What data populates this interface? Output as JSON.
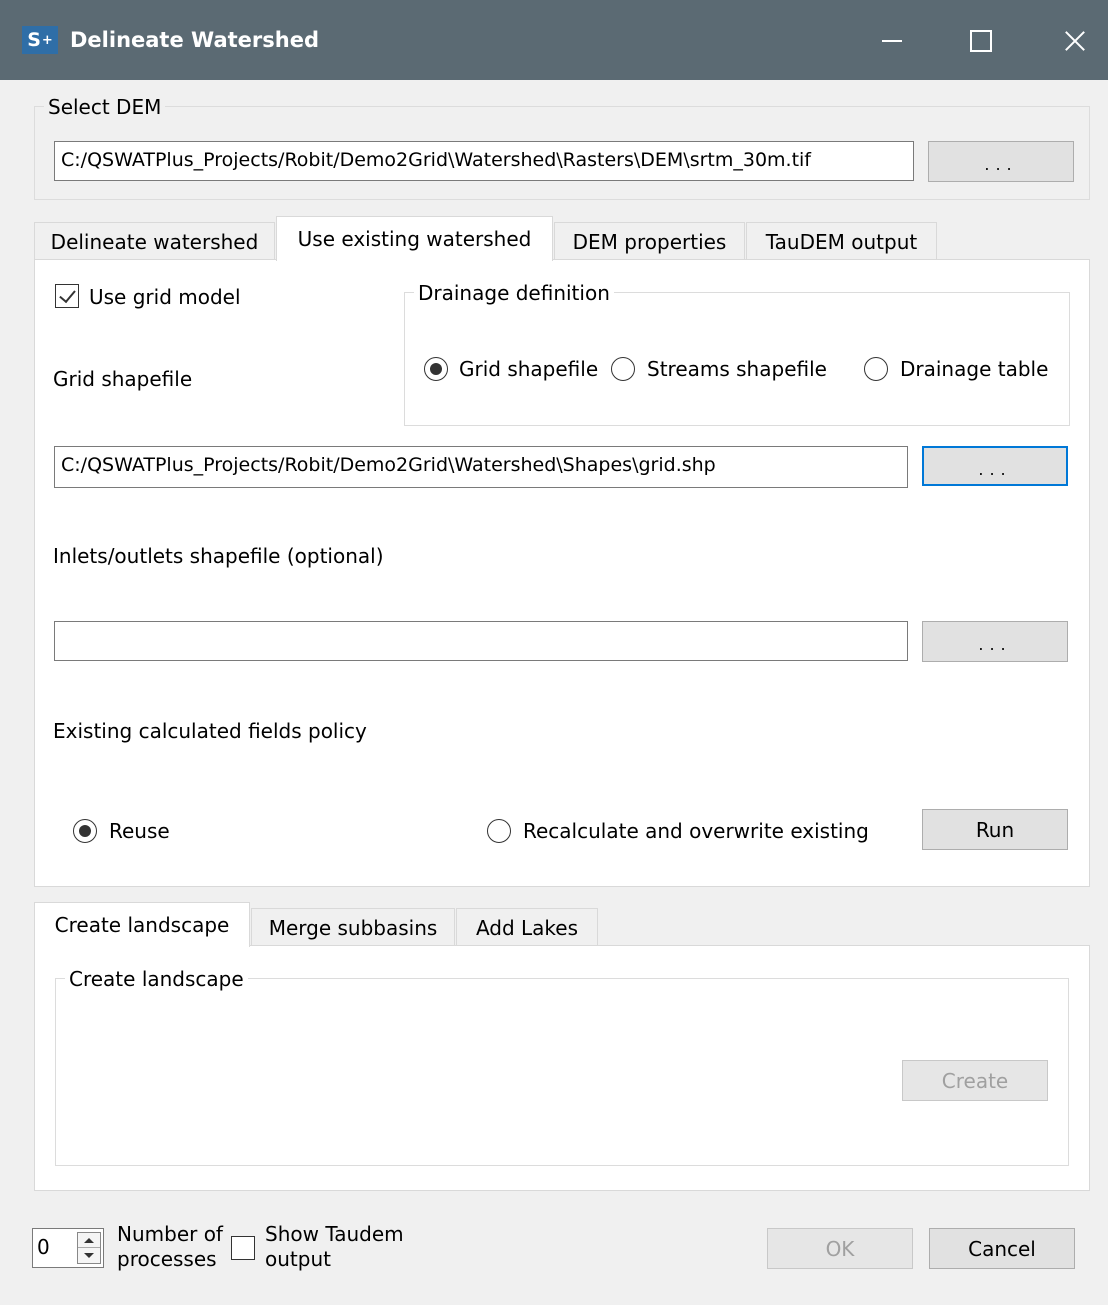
{
  "window": {
    "title": "Delineate Watershed",
    "icon_text": "S",
    "icon_sup": "+",
    "icon": "qswat-plus-icon",
    "controls": [
      "minimize-icon",
      "maximize-icon",
      "close-icon"
    ],
    "titlebar_color": "#5b6a73"
  },
  "select_dem": {
    "group_label": "Select DEM",
    "path": "C:/QSWATPlus_Projects/Robit/Demo2Grid\\Watershed\\Rasters\\DEM\\srtm_30m.tif",
    "browse_label": "..."
  },
  "top_tabs": {
    "items": [
      "Delineate watershed",
      "Use existing watershed",
      "DEM properties",
      "TauDEM output"
    ],
    "active": "Use existing watershed"
  },
  "existing": {
    "use_grid_label": "Use grid model",
    "use_grid_checked": true,
    "drainage_group_label": "Drainage definition",
    "drainage_options": [
      "Grid shapefile",
      "Streams shapefile",
      "Drainage table"
    ],
    "drainage_selected": "Grid shapefile",
    "grid_shapefile_label": "Grid shapefile",
    "grid_path": "C:/QSWATPlus_Projects/Robit/Demo2Grid\\Watershed\\Shapes\\grid.shp",
    "grid_browse_label": "...",
    "inlets_label": "Inlets/outlets shapefile (optional)",
    "inlets_path": "",
    "inlets_browse_label": "...",
    "policy_label": "Existing calculated fields policy",
    "policy_options": [
      "Reuse",
      "Recalculate and overwrite existing"
    ],
    "policy_selected": "Reuse",
    "run_label": "Run"
  },
  "bottom_tabs": {
    "items": [
      "Create landscape",
      "Merge subbasins",
      "Add Lakes"
    ],
    "active": "Create landscape",
    "group_label": "Create landscape",
    "create_label": "Create"
  },
  "footer": {
    "processes_value": "0",
    "processes_label_line1": "Number of",
    "processes_label_line2": "processes",
    "show_taudem_line1": "Show Taudem",
    "show_taudem_line2": "output",
    "show_taudem_checked": false,
    "ok_label": "OK",
    "cancel_label": "Cancel"
  },
  "colors": {
    "focus_border": "#0078d7",
    "disabled_text": "#a0a0a0"
  }
}
